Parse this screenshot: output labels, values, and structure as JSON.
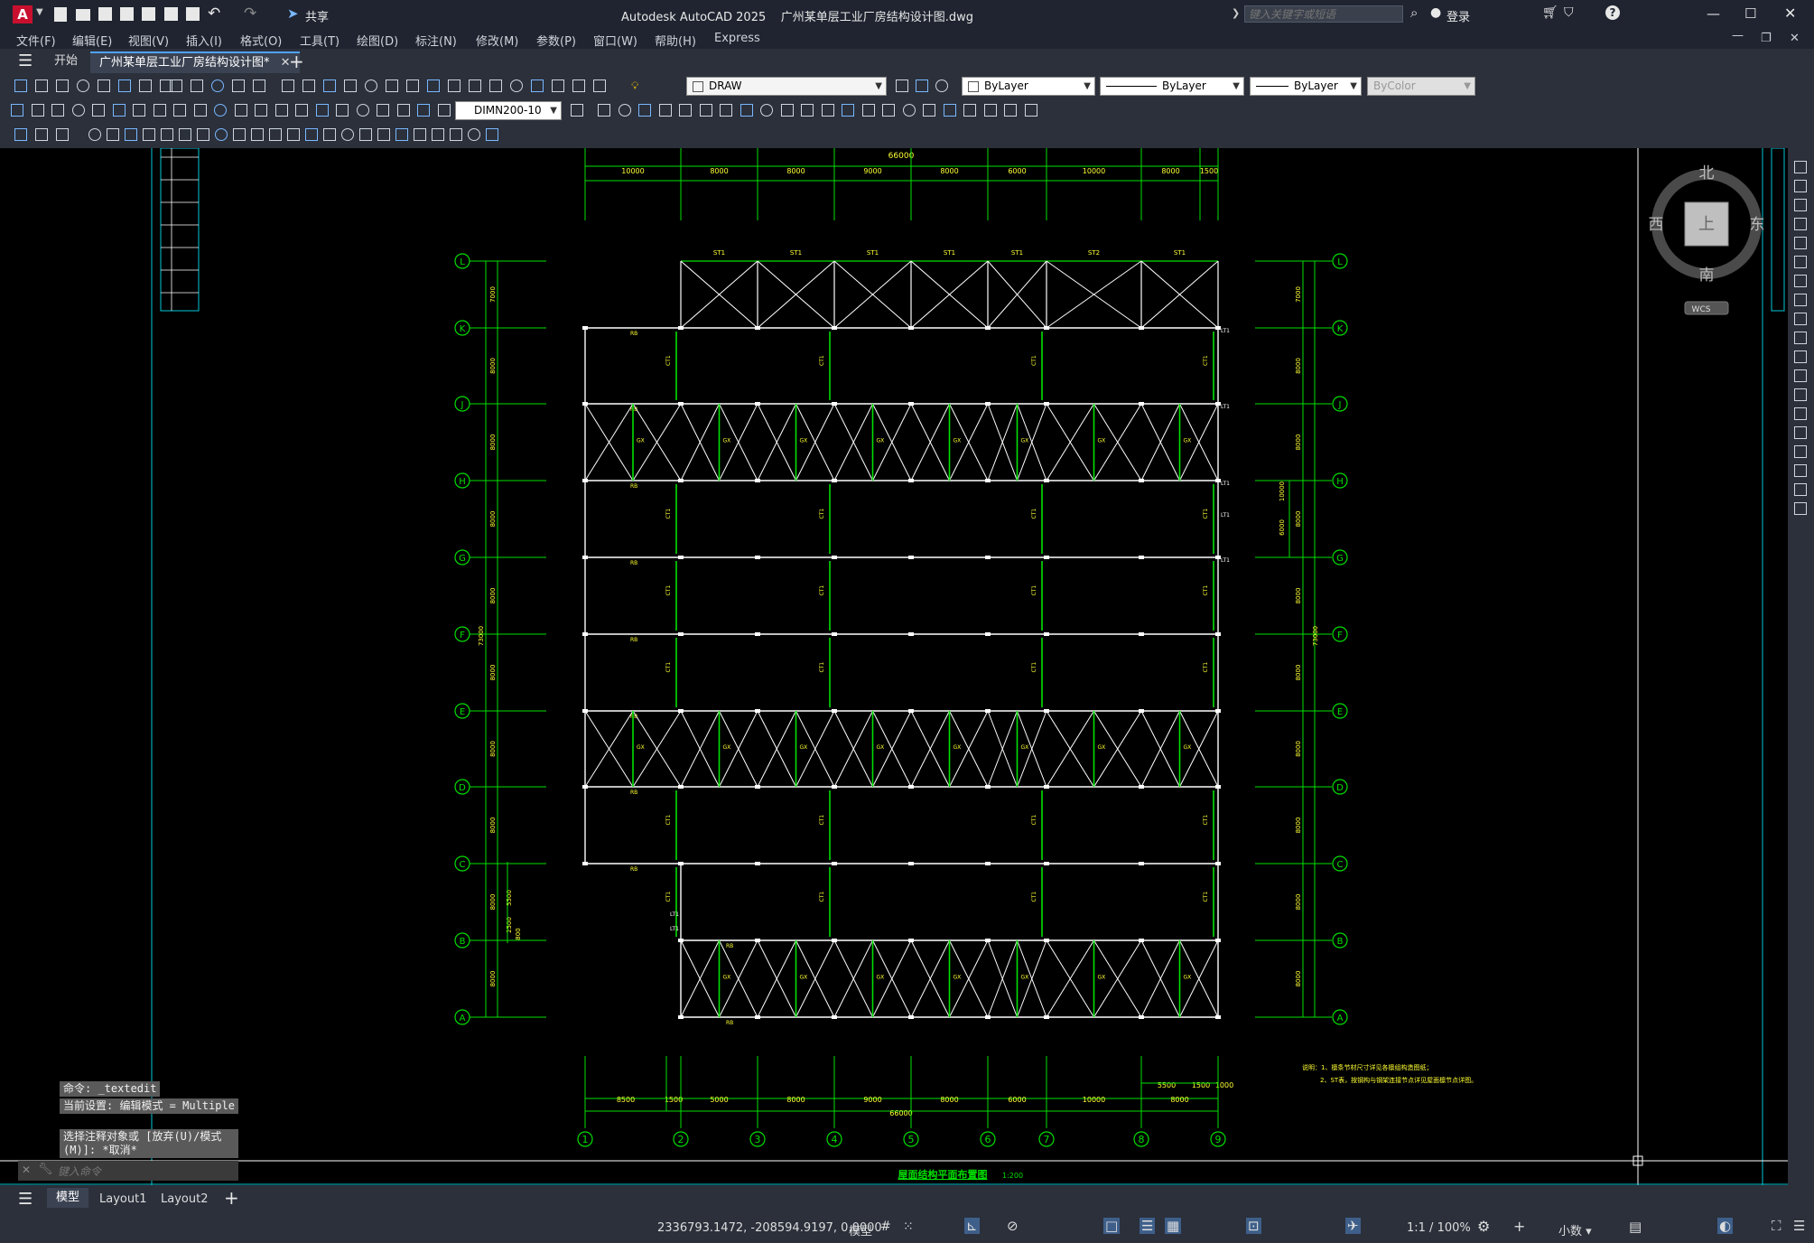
{
  "app": {
    "title": "Autodesk AutoCAD 2025    广州某单层工业厂房结构设计图.dwg",
    "logo_letter": "A",
    "share_label": "共享",
    "search_placeholder": "键入关键字或短语",
    "login_label": "登录"
  },
  "menu": [
    "文件(F)",
    "编辑(E)",
    "视图(V)",
    "插入(I)",
    "格式(O)",
    "工具(T)",
    "绘图(D)",
    "标注(N)",
    "修改(M)",
    "参数(P)",
    "窗口(W)",
    "帮助(H)",
    "Express"
  ],
  "tabs": {
    "start": "开始",
    "doc": "广州某单层工业厂房结构设计图*"
  },
  "toolbar": {
    "layer": "DRAW",
    "color": "ByLayer",
    "linetype": "ByLayer",
    "lineweight": "ByLayer",
    "plotstyle": "ByColor",
    "dimstyle": "DIMN200-10"
  },
  "viewcube": {
    "north": "北",
    "south": "南",
    "east": "东",
    "west": "西",
    "top": "上",
    "wcs": "WCS"
  },
  "drawing": {
    "title": "屋面结构平面布置图",
    "scale": "1:200",
    "total_dim": "66000",
    "top_dims": [
      "10000",
      "8000",
      "8000",
      "9000",
      "8000",
      "6000",
      "10000",
      "8000",
      "1500"
    ],
    "bottom_dims": [
      "8500",
      "1500",
      "5000",
      "8000",
      "9000",
      "8000",
      "6000",
      "10000",
      "8000"
    ],
    "bottom_extra_dims": [
      "5500",
      "1500",
      "1000"
    ],
    "row_axes": [
      "L",
      "K",
      "J",
      "H",
      "G",
      "F",
      "E",
      "D",
      "C",
      "B",
      "A"
    ],
    "col_axes": [
      "1",
      "2",
      "3",
      "4",
      "5",
      "6",
      "7",
      "8",
      "9"
    ],
    "left_dims": [
      "7000",
      "8000",
      "8000",
      "8000",
      "8000",
      "8000",
      "8000",
      "8000",
      "8000",
      "8000",
      "8000"
    ],
    "left_total": "73000",
    "left_small": [
      "5500",
      "2500",
      "800"
    ],
    "right_dims": [
      "7000",
      "8000",
      "8000",
      "8000",
      "8000",
      "8000",
      "8000",
      "8000",
      "8000",
      "8000",
      "8000"
    ],
    "right_total": "73000",
    "right_small": [
      "10000",
      "6000"
    ],
    "notes": [
      "说明：1、檩条节材尺寸详见各檩组构造图纸；",
      "2、ST表，按钢构与钢架连接节点详见屋面檩节点详图。"
    ],
    "labels": {
      "truss": "ST1",
      "truss2": "ST2",
      "purlin": "RB",
      "brace": "GX",
      "tie": "CT1",
      "rbar": "LT1"
    }
  },
  "command": {
    "line1": "命令: _textedit",
    "line2": "当前设置: 编辑模式 = Multiple",
    "line3": "选择注释对象或 [放弃(U)/模式(M)]: *取消*",
    "input_placeholder": "键入命令"
  },
  "layouts": [
    "模型",
    "Layout1",
    "Layout2"
  ],
  "status": {
    "coords": "2336793.1472, -208594.9197, 0.0000",
    "model": "模型",
    "scale": "1:1 / 100%",
    "units": "小数"
  }
}
